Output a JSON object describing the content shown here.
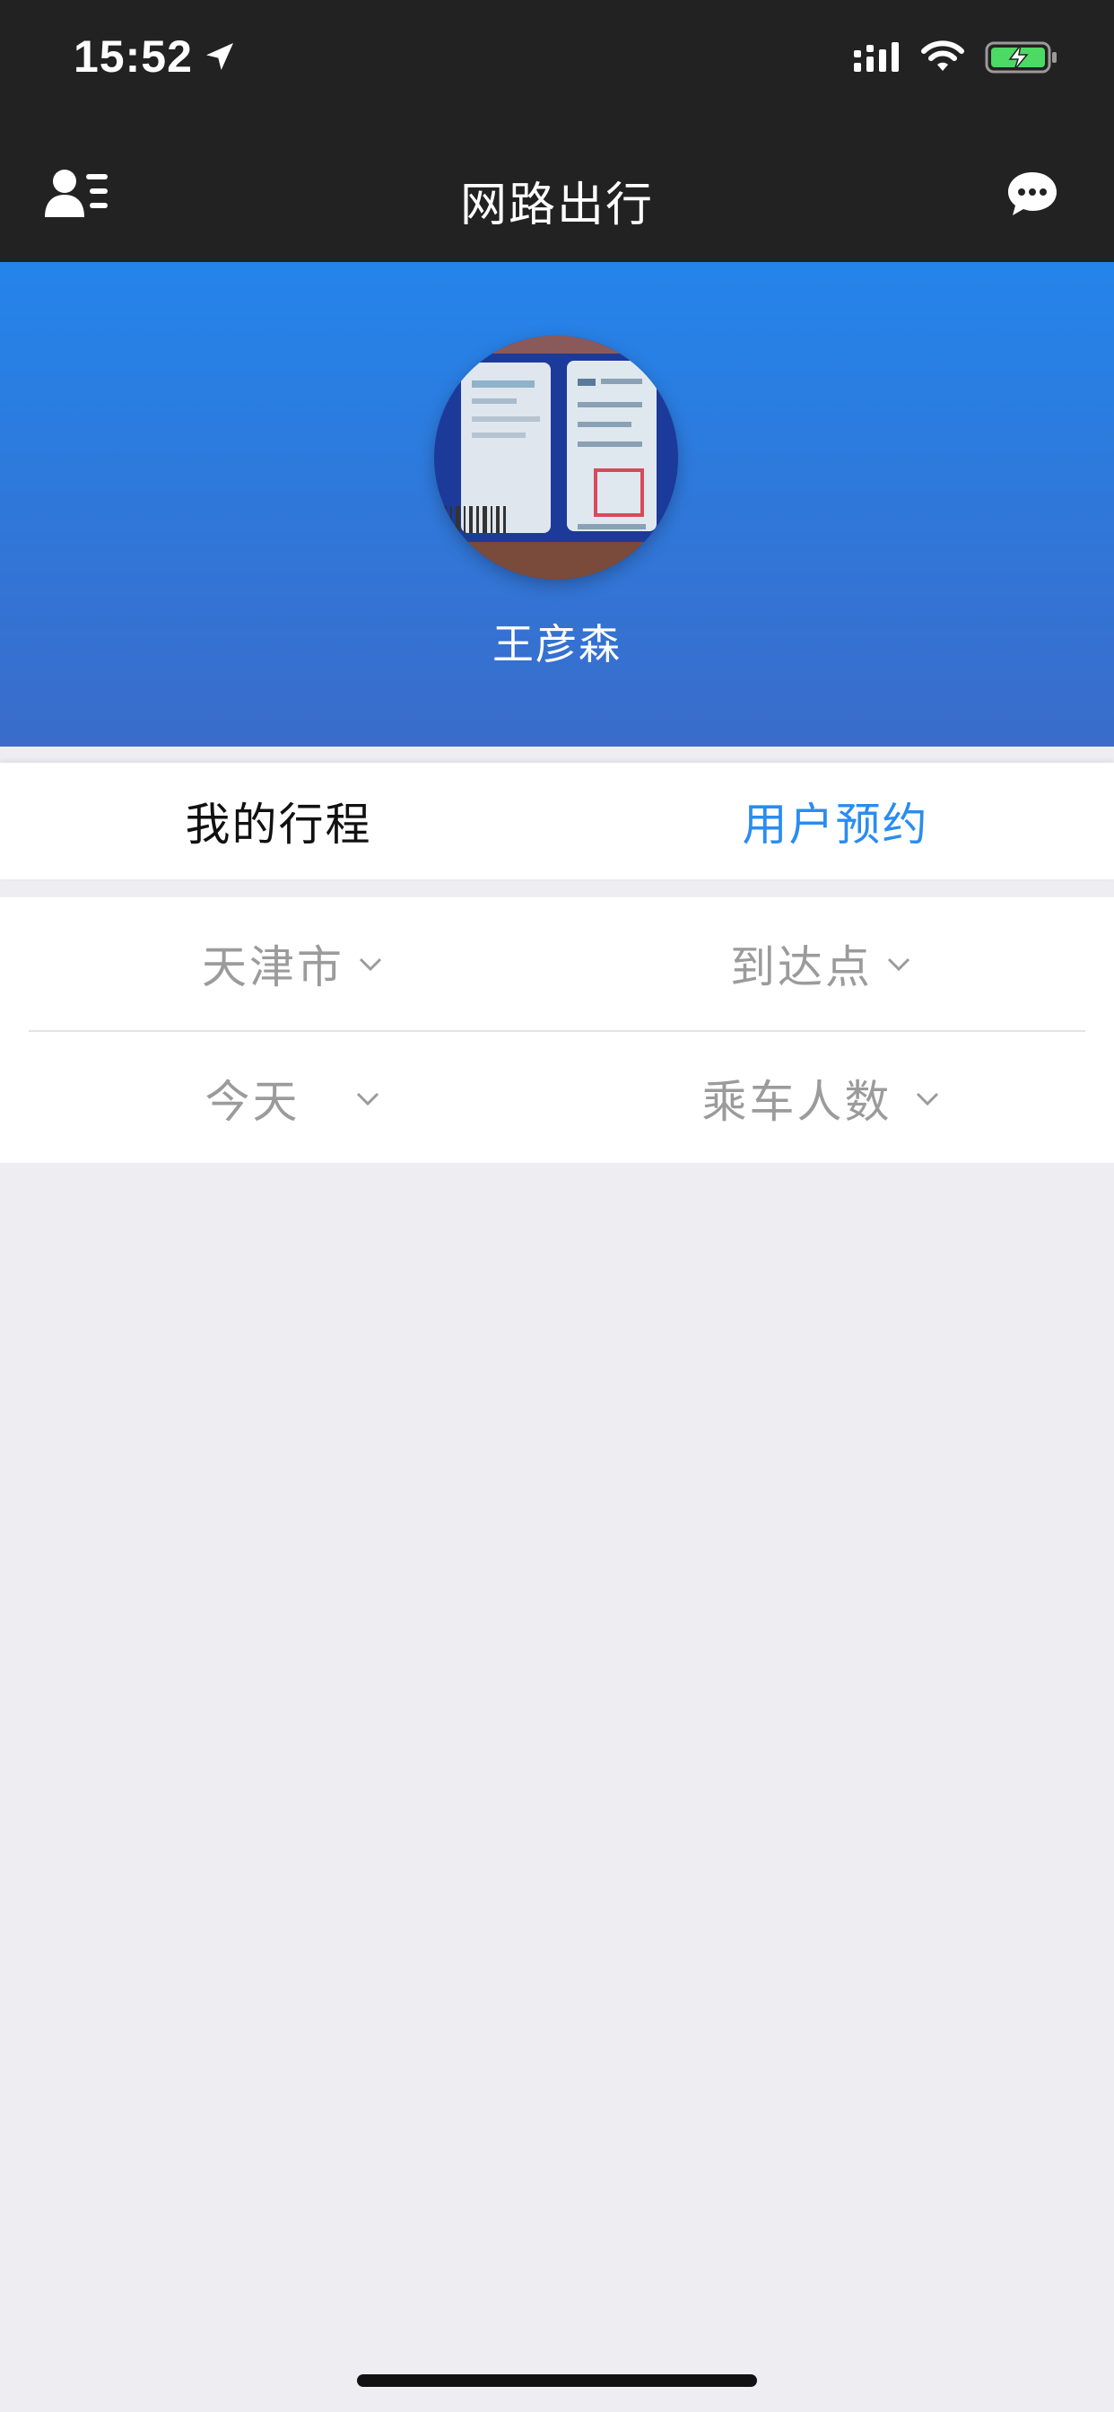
{
  "status_bar": {
    "time": "15:52"
  },
  "nav": {
    "title": "网路出行"
  },
  "profile": {
    "user_name": "王彦森"
  },
  "tabs": [
    {
      "label": "我的行程",
      "active": false
    },
    {
      "label": "用户预约",
      "active": true
    }
  ],
  "filters": {
    "departure_city": "天津市",
    "arrival_point": "到达点",
    "date": "今天",
    "passenger_count": "乘车人数"
  },
  "colors": {
    "accent": "#2a8cf0",
    "header_bg": "#222222",
    "profile_gradient_top": "#2484ea",
    "profile_gradient_bottom": "#3a6cca",
    "page_bg": "#ededf2"
  },
  "icons": {
    "nav_left": "contacts-list-icon",
    "nav_right": "message-bubble-icon",
    "status": [
      "location-arrow-icon",
      "signal-icon",
      "wifi-icon",
      "battery-charging-icon"
    ]
  }
}
